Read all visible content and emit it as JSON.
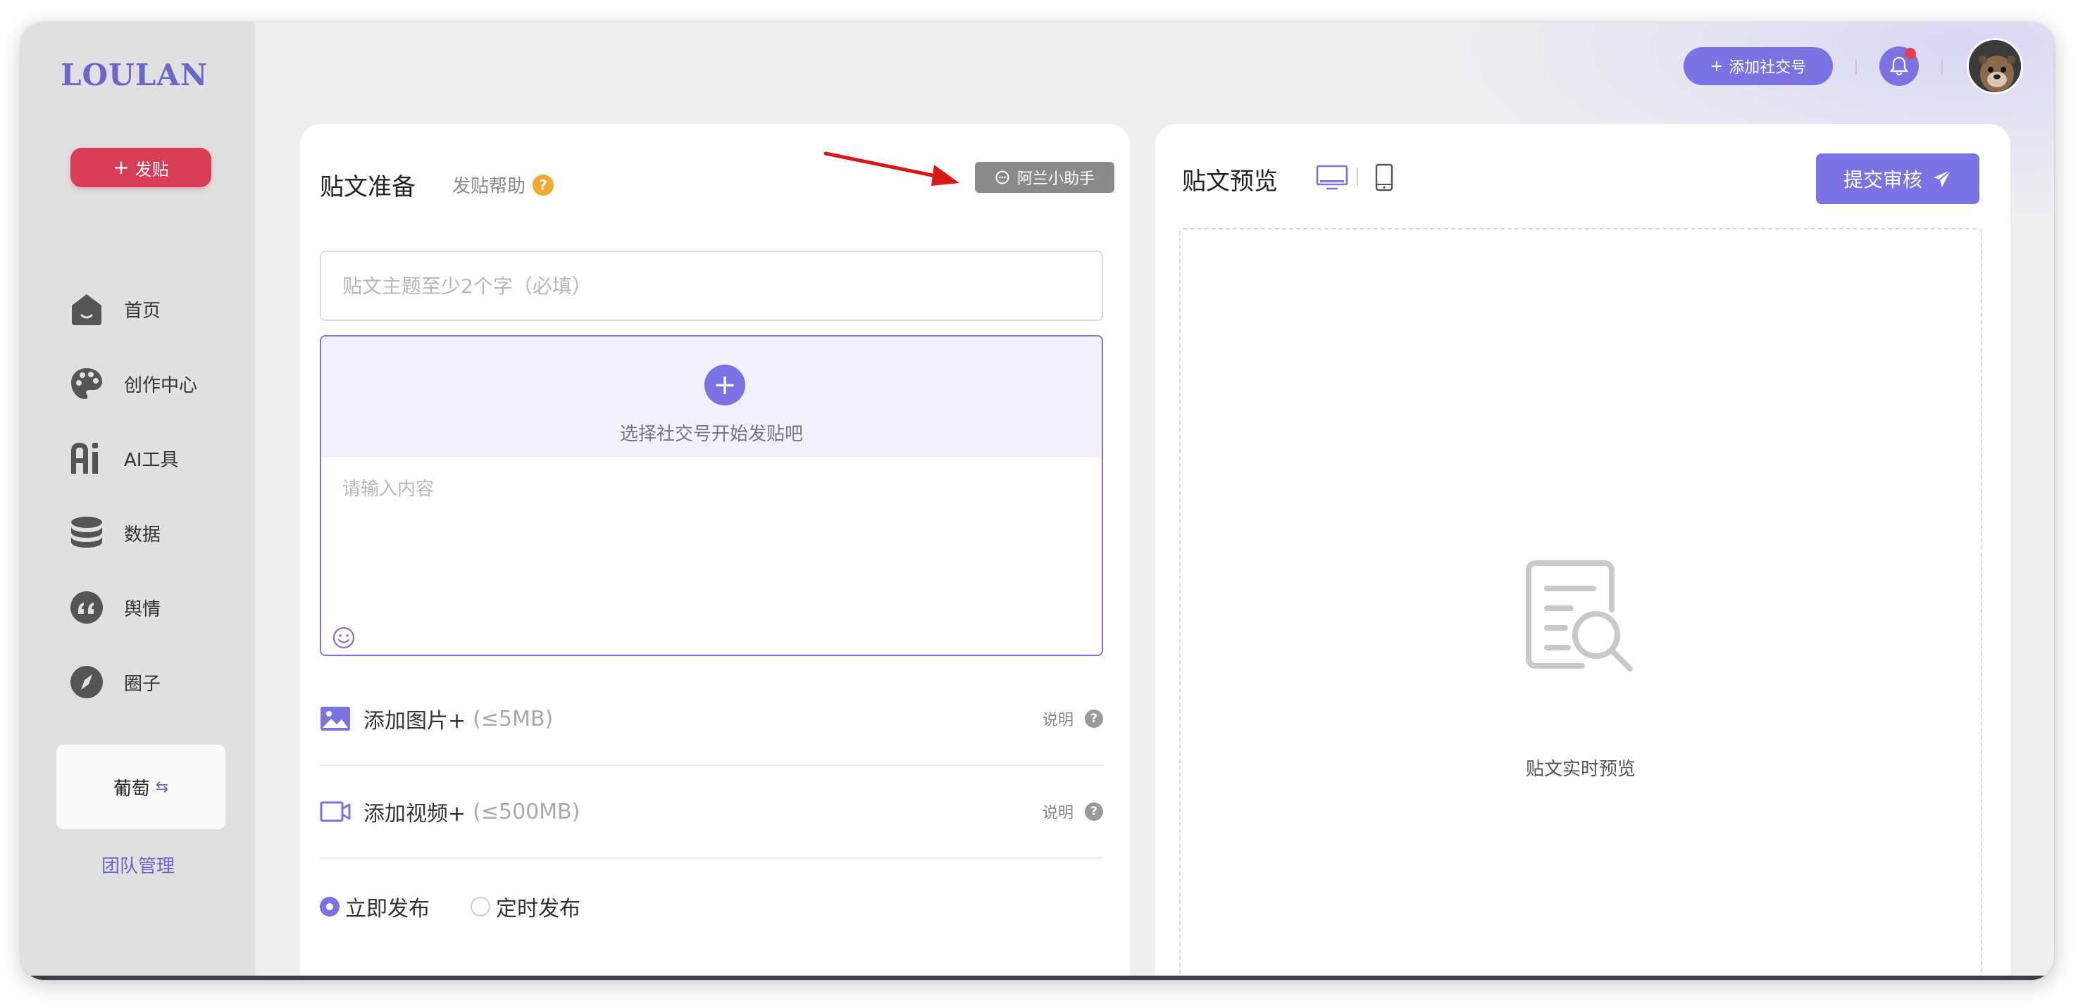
{
  "sidebar": {
    "logo": "LOULAN",
    "post_button": "发贴",
    "items": [
      {
        "label": "首页",
        "icon": "home-icon"
      },
      {
        "label": "创作中心",
        "icon": "palette-icon"
      },
      {
        "label": "AI工具",
        "icon": "ai-icon"
      },
      {
        "label": "数据",
        "icon": "database-icon"
      },
      {
        "label": "舆情",
        "icon": "quote-icon"
      },
      {
        "label": "圈子",
        "icon": "compass-icon"
      }
    ],
    "team_name": "葡萄",
    "team_manage": "团队管理"
  },
  "header": {
    "add_social": "添加社交号",
    "has_notification": true
  },
  "compose": {
    "title": "贴文准备",
    "help": "发贴帮助",
    "assistant": "阿兰小助手",
    "topic_placeholder": "贴文主题至少2个字（必填）",
    "select_account": "选择社交号开始发贴吧",
    "content_placeholder": "请输入内容",
    "add_image": "添加图片+",
    "image_limit": "(≤5MB)",
    "add_video": "添加视频+",
    "video_limit": "(≤500MB)",
    "desc_label": "说明",
    "publish_now": "立即发布",
    "publish_scheduled": "定时发布",
    "selected_publish": "立即发布"
  },
  "preview": {
    "title": "贴文预览",
    "submit": "提交审核",
    "empty_text": "贴文实时预览",
    "active_device": "desktop"
  },
  "colors": {
    "accent": "#7b73e4",
    "post_red": "#d93d57",
    "help_orange": "#f0a82e"
  }
}
